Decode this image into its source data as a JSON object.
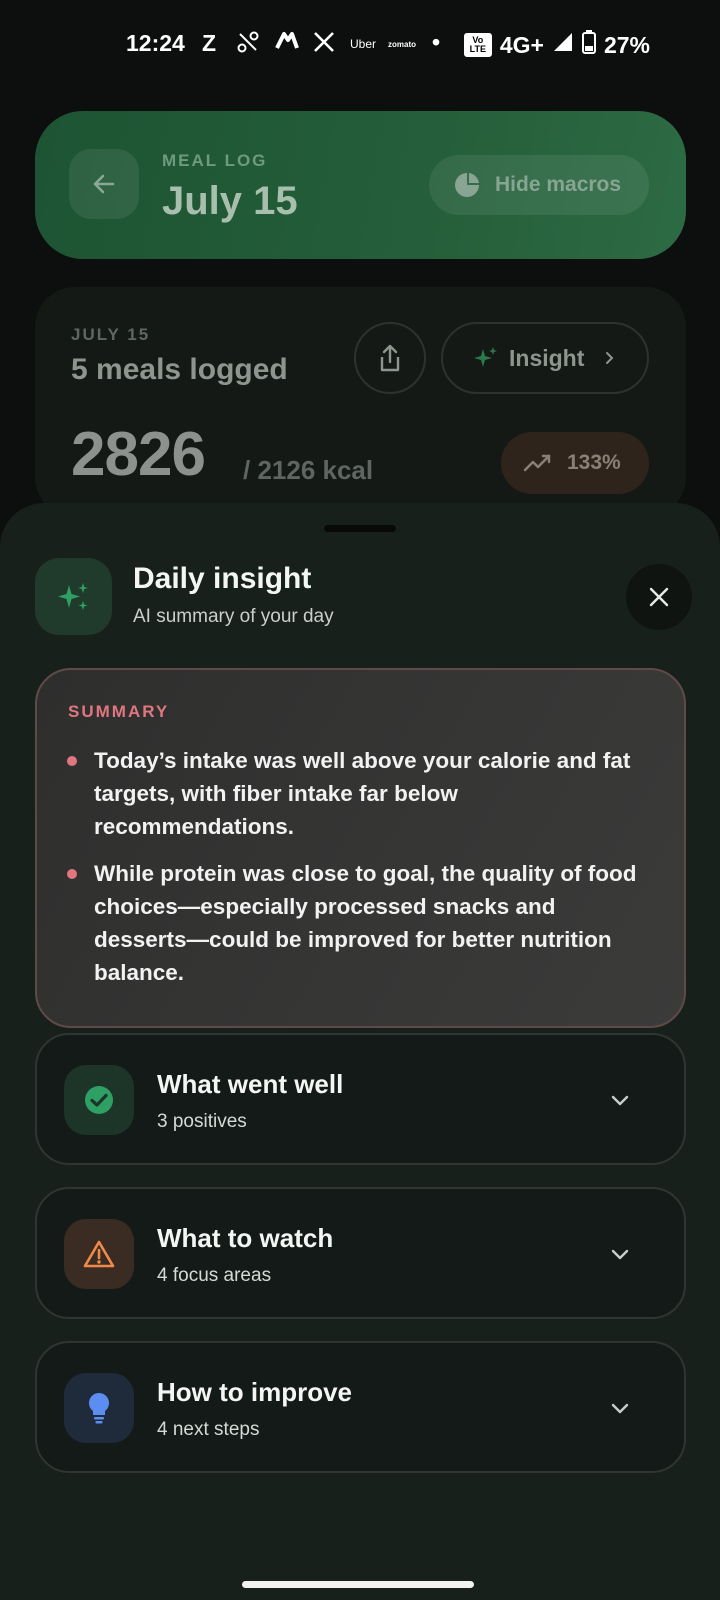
{
  "status_bar": {
    "time": "12:24",
    "notification_icons": [
      "Z",
      "Uber",
      "zomato",
      "•"
    ],
    "volte": "Vo LTE",
    "network": "4G+",
    "battery": "27%"
  },
  "header": {
    "label": "MEAL LOG",
    "date": "July 15",
    "hide_macros": "Hide macros"
  },
  "day_summary": {
    "date_label": "JULY 15",
    "meals_logged": "5 meals logged",
    "insight_button": "Insight",
    "calories": "2826",
    "calorie_goal": "/ 2126 kcal",
    "percent": "133%"
  },
  "sheet": {
    "title": "Daily insight",
    "subtitle": "AI summary of your day",
    "summary_label": "SUMMARY",
    "summary_points": [
      "Today’s intake was well above your calorie and fat targets, with fiber intake far below recommendations.",
      "While protein was close to goal, the quality of food choices—especially processed snacks and desserts—could be improved for better nutrition balance."
    ],
    "sections": [
      {
        "title": "What went well",
        "subtitle": "3 positives",
        "icon": "check-circle-icon",
        "color": "#2ea064",
        "bg": "#1c3528"
      },
      {
        "title": "What to watch",
        "subtitle": "4 focus areas",
        "icon": "warning-icon",
        "color": "#f08a4b",
        "bg": "#3a2c22"
      },
      {
        "title": "How to improve",
        "subtitle": "4 next steps",
        "icon": "lightbulb-icon",
        "color": "#5b8ef0",
        "bg": "#1f2a3a"
      }
    ]
  },
  "colors": {
    "accent_green": "#2ea064",
    "summary_red": "#e07780",
    "sheet_bg": "#18201c"
  }
}
